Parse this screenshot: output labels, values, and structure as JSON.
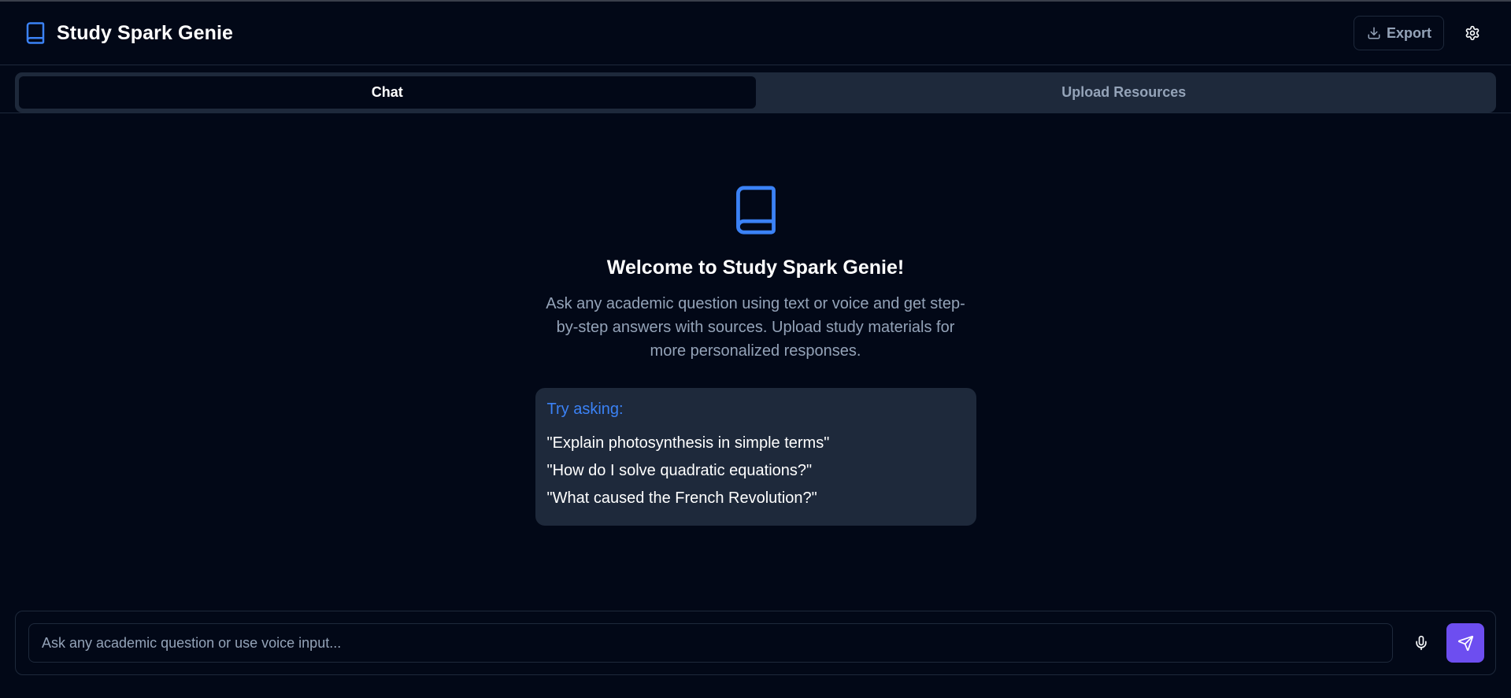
{
  "app": {
    "title": "Study Spark Genie",
    "logo_icon": "book-icon"
  },
  "header": {
    "export_label": "Export",
    "export_icon": "download-icon",
    "settings_icon": "gear-icon"
  },
  "tabs": [
    {
      "label": "Chat",
      "active": true
    },
    {
      "label": "Upload Resources",
      "active": false
    }
  ],
  "welcome": {
    "icon": "book-icon",
    "title": "Welcome to Study Spark Genie!",
    "description": "Ask any academic question using text or voice and get step-by-step answers with sources. Upload study materials for more personalized responses.",
    "suggestions_title": "Try asking:",
    "suggestions": [
      "\"Explain photosynthesis in simple terms\"",
      "\"How do I solve quadratic equations?\"",
      "\"What caused the French Revolution?\""
    ]
  },
  "composer": {
    "placeholder": "Ask any academic question or use voice input...",
    "value": "",
    "mic_icon": "microphone-icon",
    "send_icon": "send-icon"
  },
  "colors": {
    "background": "#020817",
    "surface": "#1e293b",
    "accent_blue": "#3b82f6",
    "send_button": "#6d4ef0",
    "muted_text": "#94a3b8"
  }
}
